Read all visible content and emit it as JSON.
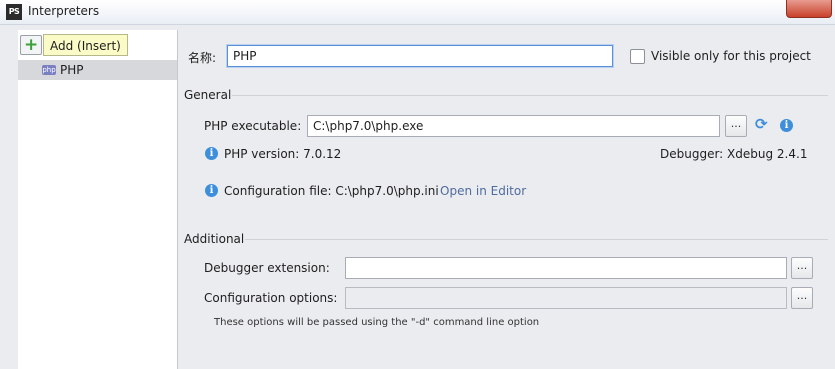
{
  "window": {
    "app_icon": "PS",
    "title": "Interpreters"
  },
  "sidebar": {
    "add_button_symbol": "+",
    "add_tooltip": "Add (Insert)",
    "items": [
      {
        "icon_text": "php",
        "label": "PHP"
      }
    ]
  },
  "form": {
    "name_label": "名称:",
    "name_value": "PHP",
    "visible_only_label": "Visible only for this project",
    "visible_only_checked": false,
    "general": {
      "header": "General",
      "executable_label": "PHP executable:",
      "executable_value": "C:\\php7.0\\php.exe",
      "browse_symbol": "...",
      "version_text": "PHP version: 7.0.12",
      "debugger_text": "Debugger: Xdebug 2.4.1",
      "config_file_text": "Configuration file: C:\\php7.0\\php.ini",
      "open_in_editor": "Open in Editor"
    },
    "additional": {
      "header": "Additional",
      "debugger_extension_label": "Debugger extension:",
      "debugger_extension_value": "",
      "config_options_label": "Configuration options:",
      "config_options_value": "",
      "hint": "These options will be passed using the \"-d\" command line option"
    }
  },
  "icons": {
    "info": "info-icon",
    "refresh": "refresh-icon",
    "add": "plus-icon",
    "info_color": "#3d8edb",
    "add_color": "#3aa23a"
  }
}
